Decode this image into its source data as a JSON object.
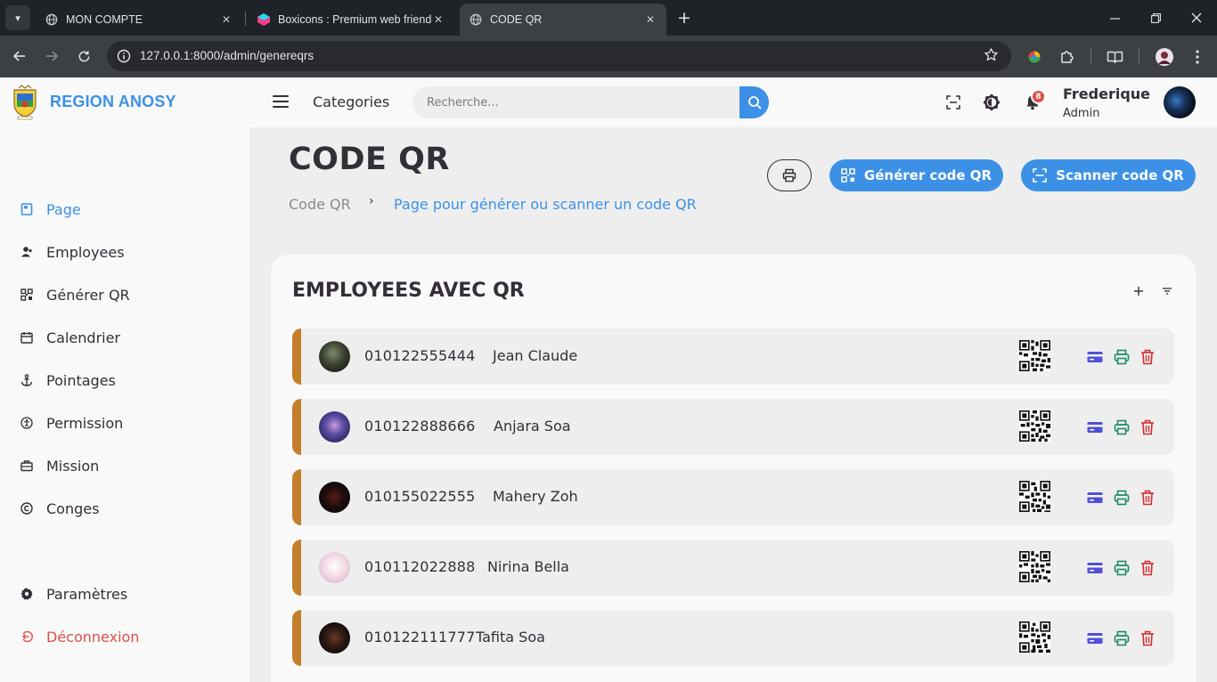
{
  "browser": {
    "tabs": [
      {
        "title": "MON COMPTE",
        "active": false
      },
      {
        "title": "Boxicons : Premium web friendly icons",
        "active": false
      },
      {
        "title": "CODE QR",
        "active": true
      }
    ],
    "url": "127.0.0.1:8000/admin/genereqrs"
  },
  "header": {
    "brand": "REGION ANOSY",
    "categories": "Categories",
    "search_placeholder": "Recherche...",
    "notifications": "8",
    "user_name": "Frederique",
    "user_role": "Admin"
  },
  "sidebar": {
    "items": [
      {
        "label": "Page",
        "icon": "page-icon",
        "active": true
      },
      {
        "label": "Employees",
        "icon": "user-icon"
      },
      {
        "label": "Générer QR",
        "icon": "qr-scan-icon"
      },
      {
        "label": "Calendrier",
        "icon": "calendar-icon"
      },
      {
        "label": "Pointages",
        "icon": "anchor-icon"
      },
      {
        "label": "Permission",
        "icon": "accessibility-icon"
      },
      {
        "label": "Mission",
        "icon": "briefcase-icon"
      },
      {
        "label": "Conges",
        "icon": "copyright-icon"
      }
    ],
    "settings": "Paramètres",
    "logout": "Déconnexion"
  },
  "main": {
    "title": "CODE QR",
    "breadcrumb": [
      "Code QR",
      "Page pour générer ou scanner un code QR"
    ],
    "generate_label": "Générer code QR",
    "scan_label": "Scanner code QR",
    "card_title": "EMPLOYEES AVEC QR",
    "rows": [
      {
        "id": "010122555444",
        "name": "Jean Claude"
      },
      {
        "id": "010122888666",
        "name": "Anjara Soa"
      },
      {
        "id": "010155022555",
        "name": "Mahery Zoh"
      },
      {
        "id": "010112022888",
        "name": "Nirina Bella"
      },
      {
        "id": "010122111777",
        "name": "Tafita Soa"
      }
    ]
  },
  "colors": {
    "accent": "#3c91e6",
    "row_border": "#c47f2a",
    "danger": "#db504a",
    "card_icon": "#4f4fdb",
    "print_icon": "#1f8a6a",
    "trash_icon": "#d32f2f"
  }
}
